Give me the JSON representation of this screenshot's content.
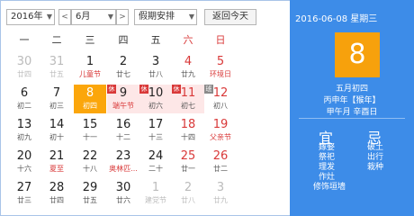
{
  "toolbar": {
    "year": "2016年",
    "month": "6月",
    "holiday": "假期安排",
    "today_label": "返回今天"
  },
  "weekdays": [
    "一",
    "二",
    "三",
    "四",
    "五",
    "六",
    "日"
  ],
  "days": [
    {
      "n": "30",
      "l": "廿四",
      "t": "prev"
    },
    {
      "n": "31",
      "l": "廿五",
      "t": "prev"
    },
    {
      "n": "1",
      "l": "儿童节",
      "lr": 1
    },
    {
      "n": "2",
      "l": "廿七"
    },
    {
      "n": "3",
      "l": "廿八"
    },
    {
      "n": "4",
      "l": "廿九",
      "w": 1
    },
    {
      "n": "5",
      "l": "环境日",
      "lr": 1,
      "w": 1
    },
    {
      "n": "6",
      "l": "初二"
    },
    {
      "n": "7",
      "l": "初三"
    },
    {
      "n": "8",
      "l": "初四",
      "sel": 1
    },
    {
      "n": "9",
      "l": "端午节",
      "lr": 1,
      "hol": 1,
      "b": "休"
    },
    {
      "n": "10",
      "l": "初六",
      "hol": 1,
      "b": "休"
    },
    {
      "n": "11",
      "l": "初七",
      "hol": 1,
      "w": 1,
      "b": "休"
    },
    {
      "n": "12",
      "l": "初八",
      "w": 1,
      "b": "班",
      "bw": 1
    },
    {
      "n": "13",
      "l": "初九"
    },
    {
      "n": "14",
      "l": "初十"
    },
    {
      "n": "15",
      "l": "十一"
    },
    {
      "n": "16",
      "l": "十二"
    },
    {
      "n": "17",
      "l": "十三"
    },
    {
      "n": "18",
      "l": "十四",
      "w": 1
    },
    {
      "n": "19",
      "l": "父亲节",
      "lr": 1,
      "w": 1
    },
    {
      "n": "20",
      "l": "十六"
    },
    {
      "n": "21",
      "l": "夏至",
      "lr": 1
    },
    {
      "n": "22",
      "l": "十八"
    },
    {
      "n": "23",
      "l": "奥林匹...",
      "lr": 1
    },
    {
      "n": "24",
      "l": "二十"
    },
    {
      "n": "25",
      "l": "廿一",
      "w": 1
    },
    {
      "n": "26",
      "l": "廿二",
      "w": 1
    },
    {
      "n": "27",
      "l": "廿三"
    },
    {
      "n": "28",
      "l": "廿四"
    },
    {
      "n": "29",
      "l": "廿五"
    },
    {
      "n": "30",
      "l": "廿六"
    },
    {
      "n": "1",
      "l": "建党节",
      "t": "next"
    },
    {
      "n": "2",
      "l": "廿八",
      "t": "next"
    },
    {
      "n": "3",
      "l": "廿九",
      "t": "next"
    }
  ],
  "side": {
    "date": "2016-06-08 星期三",
    "big_day": "8",
    "lunar1": "五月初四",
    "lunar2": "丙申年【猴年】",
    "lunar3": "甲午月 辛酉日",
    "yi_label": "宜",
    "ji_label": "忌",
    "yi_items": [
      "嫁娶",
      "祭祀",
      "理发",
      "作灶",
      "修饰垣墙"
    ],
    "ji_items": [
      "破土",
      "出行",
      "栽种"
    ]
  }
}
